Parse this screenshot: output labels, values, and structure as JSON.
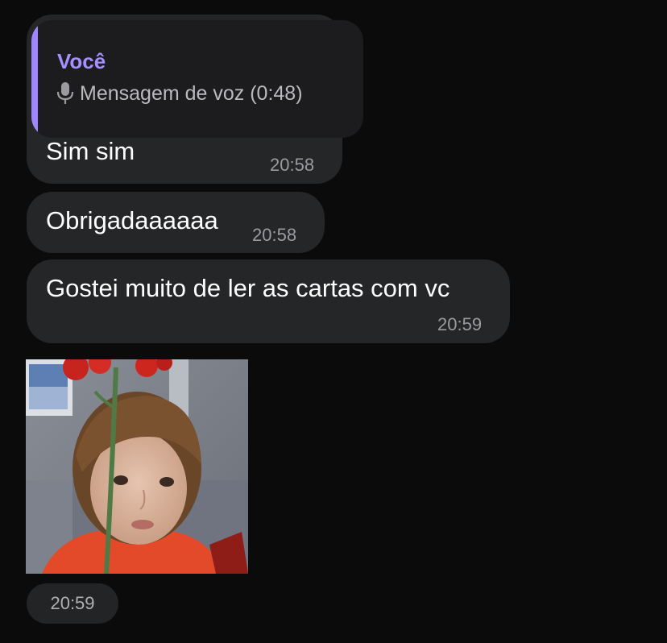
{
  "messages": [
    {
      "reply": {
        "author": "Você",
        "icon": "mic-icon",
        "preview": "Mensagem de voz (0:48)"
      },
      "text": "Sim sim",
      "time": "20:58"
    },
    {
      "text": "Obrigadaaaaaa",
      "time": "20:58"
    },
    {
      "text": "Gostei muito de ler as cartas com vc",
      "time": "20:59"
    }
  ],
  "sticker": {
    "icon": "child-holding-rose-sticker",
    "time": "20:59"
  },
  "colors": {
    "background": "#0b0b0c",
    "bubble": "#252627",
    "reply_accent": "#9d86ff",
    "timestamp": "#9a9a9f"
  }
}
